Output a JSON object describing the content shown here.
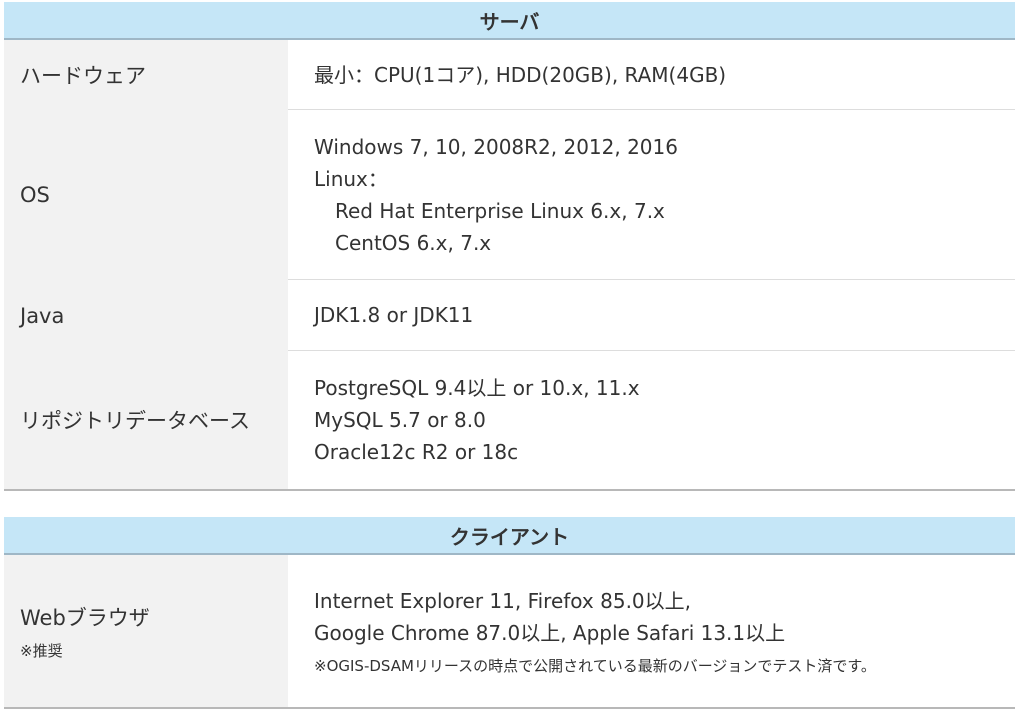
{
  "server": {
    "title": "サーバ",
    "rows": [
      {
        "label": "ハードウェア",
        "lines": [
          "最小：CPU(1コア), HDD(20GB), RAM(4GB)"
        ]
      },
      {
        "label": "OS",
        "lines": [
          "Windows 7, 10, 2008R2, 2012, 2016",
          "Linux：",
          "Red Hat Enterprise Linux 6.x, 7.x",
          "CentOS 6.x, 7.x"
        ]
      },
      {
        "label": "Java",
        "lines": [
          "JDK1.8 or JDK11"
        ]
      },
      {
        "label": "リポジトリデータベース",
        "lines": [
          "PostgreSQL 9.4以上 or 10.x, 11.x",
          "MySQL 5.7 or 8.0",
          "Oracle12c R2 or 18c"
        ]
      }
    ]
  },
  "client": {
    "title": "クライアント",
    "rows": [
      {
        "label": "Webブラウザ",
        "label_note": "※推奨",
        "lines": [
          "Internet Explorer 11, Firefox 85.0以上,",
          "Google Chrome 87.0以上, Apple Safari 13.1以上"
        ],
        "note": "※OGIS-DSAMリリースの時点で公開されている最新のバージョンでテスト済です。"
      }
    ]
  }
}
